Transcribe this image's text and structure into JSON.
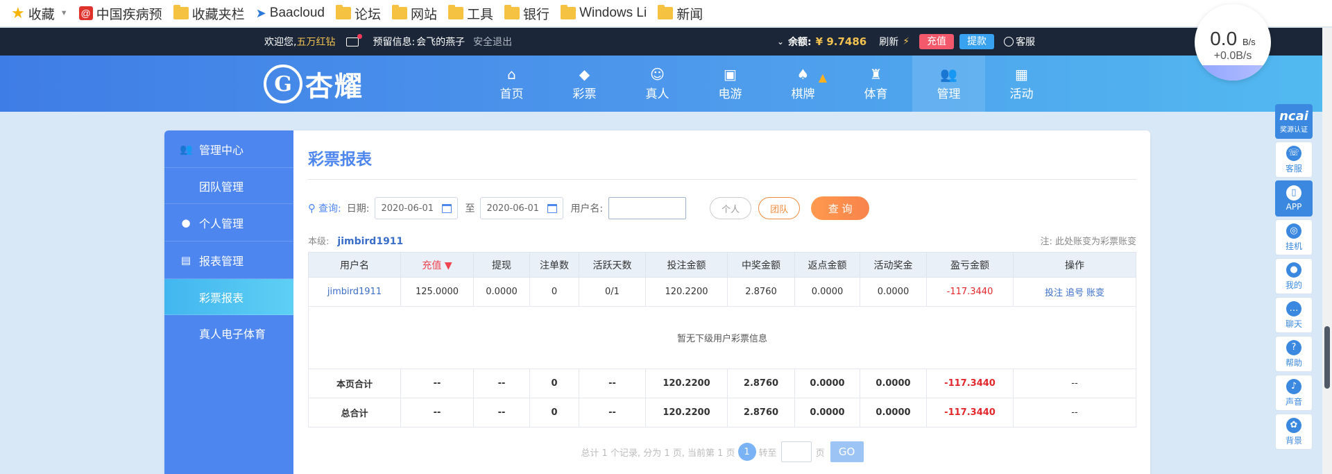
{
  "bookmarks": [
    {
      "label": "收藏",
      "icon": "star-icon"
    },
    {
      "label": "中国疾病预",
      "icon": "red-site-icon"
    },
    {
      "label": "收藏夹栏",
      "icon": "folder-icon"
    },
    {
      "label": "Baacloud",
      "icon": "paper-plane-icon"
    },
    {
      "label": "论坛",
      "icon": "folder-icon"
    },
    {
      "label": "网站",
      "icon": "folder-icon"
    },
    {
      "label": "工具",
      "icon": "folder-icon"
    },
    {
      "label": "银行",
      "icon": "folder-icon"
    },
    {
      "label": "Windows Li",
      "icon": "folder-icon"
    },
    {
      "label": "新闻",
      "icon": "folder-icon"
    }
  ],
  "topbar": {
    "welcome": "欢迎您,",
    "username": "五万红钻",
    "reserved_label": "预留信息:",
    "reserved_value": "会飞的燕子",
    "logout": "安全退出",
    "balance_label": "余额:",
    "balance": "¥ 9.7486",
    "refresh": "刷新",
    "deposit": "充值",
    "withdraw": "提款",
    "service": "客服"
  },
  "speed": {
    "main": "0.0",
    "unit": "B/s",
    "sub": "+0.0B/s"
  },
  "logo": {
    "text": "杏耀"
  },
  "nav": [
    {
      "label": "首页",
      "icon": "home-icon"
    },
    {
      "label": "彩票",
      "icon": "lottery-icon"
    },
    {
      "label": "真人",
      "icon": "live-dealer-icon"
    },
    {
      "label": "电游",
      "icon": "slot-machine-icon"
    },
    {
      "label": "棋牌",
      "icon": "chess-card-icon"
    },
    {
      "label": "体育",
      "icon": "trophy-icon"
    },
    {
      "label": "管理",
      "icon": "users-icon"
    },
    {
      "label": "活动",
      "icon": "gift-icon"
    }
  ],
  "right_tools": [
    {
      "label": "奖源认证",
      "icon": "brand-badge-icon"
    },
    {
      "label": "客服",
      "icon": "headset-icon"
    },
    {
      "label": "APP",
      "icon": "phone-icon"
    },
    {
      "label": "挂机",
      "icon": "robot-icon"
    },
    {
      "label": "我的",
      "icon": "user-icon"
    },
    {
      "label": "聊天",
      "icon": "chat-icon"
    },
    {
      "label": "帮助",
      "icon": "help-icon"
    },
    {
      "label": "声音",
      "icon": "speaker-icon"
    },
    {
      "label": "背景",
      "icon": "palette-icon"
    }
  ],
  "sidebar": {
    "groups": [
      {
        "label": "管理中心",
        "icon": "team-icon",
        "items": [
          "团队管理"
        ]
      },
      {
        "label": "个人管理",
        "icon": "person-icon",
        "items": []
      },
      {
        "label": "报表管理",
        "icon": "report-icon",
        "items": [
          "彩票报表",
          "真人电子体育"
        ]
      }
    ],
    "active_item": "彩票报表"
  },
  "page": {
    "title": "彩票报表"
  },
  "query": {
    "label": "查询:",
    "date_label": "日期:",
    "date_from": "2020-06-01",
    "to": "至",
    "date_to": "2020-06-01",
    "user_label": "用户名:",
    "user_value": "",
    "btn_personal": "个人",
    "btn_team": "团队",
    "btn_search": "查 询"
  },
  "level": {
    "label": "本级:",
    "user": "jimbird1911",
    "note": "注: 此处账变为彩票账变"
  },
  "table": {
    "headers": [
      "用户名",
      "充值 ▼",
      "提现",
      "注单数",
      "活跃天数",
      "投注金额",
      "中奖金额",
      "返点金额",
      "活动奖金",
      "盈亏金额",
      "操作"
    ],
    "row": [
      "jimbird1911",
      "125.0000",
      "0.0000",
      "0",
      "0/1",
      "120.2200",
      "2.8760",
      "0.0000",
      "0.0000",
      "-117.3440"
    ],
    "row_ops": [
      "投注",
      "追号",
      "账变"
    ],
    "empty_msg": "暂无下级用户彩票信息",
    "page_total": [
      "本页合计",
      "--",
      "--",
      "0",
      "--",
      "120.2200",
      "2.8760",
      "0.0000",
      "0.0000",
      "-117.3440",
      "--"
    ],
    "grand_total": [
      "总合计",
      "--",
      "--",
      "0",
      "--",
      "120.2200",
      "2.8760",
      "0.0000",
      "0.0000",
      "-117.3440",
      "--"
    ]
  },
  "pager": {
    "summary": "总计 1 个记录, 分为 1 页, 当前第 1 页",
    "current": "1",
    "goto": "转至",
    "page_unit": "页",
    "go": "GO"
  }
}
